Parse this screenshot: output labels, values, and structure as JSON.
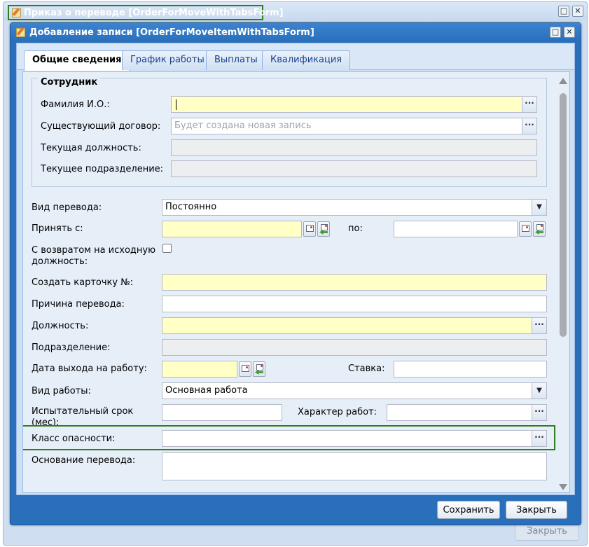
{
  "outer_window": {
    "title": "Приказ о переводе [OrderForMoveWithTabsForm]",
    "bg_close_button": "Закрыть"
  },
  "dialog": {
    "title": "Добавление записи [OrderForMoveItemWithTabsForm]",
    "buttons": {
      "save": "Сохранить",
      "close": "Закрыть"
    }
  },
  "tabs": [
    {
      "label": "Общие сведения",
      "active": true
    },
    {
      "label": "График работы",
      "active": false
    },
    {
      "label": "Выплаты",
      "active": false
    },
    {
      "label": "Квалификация",
      "active": false
    }
  ],
  "employee": {
    "legend": "Сотрудник",
    "fio_label": "Фамилия И.О.:",
    "fio_value": "",
    "contract_label": "Существующий договор:",
    "contract_placeholder": "Будет создана новая запись",
    "position_label": "Текущая должность:",
    "position_value": "",
    "department_label": "Текущее подразделение:",
    "department_value": ""
  },
  "form": {
    "transfer_type_label": "Вид перевода:",
    "transfer_type_value": "Постоянно",
    "accept_from_label": "Принять с:",
    "accept_from_value": "",
    "to_label": "по:",
    "to_value": "",
    "return_label": "С возвратом на исходную должность:",
    "return_checked": false,
    "card_label": "Создать карточку №:",
    "card_value": "",
    "reason_label": "Причина перевода:",
    "reason_value": "",
    "position_label": "Должность:",
    "position_value": "",
    "department_label": "Подразделение:",
    "department_value": "",
    "start_date_label": "Дата выхода на работу:",
    "start_date_value": "",
    "rate_label": "Ставка:",
    "rate_value": "",
    "work_type_label": "Вид работы:",
    "work_type_value": "Основная работа",
    "probation_label": "Испытательный срок (мес):",
    "probation_value": "",
    "work_nature_label": "Характер работ:",
    "work_nature_value": "",
    "hazard_class_label": "Класс опасности:",
    "hazard_class_value": "",
    "basis_label": "Основание перевода:",
    "basis_value": ""
  },
  "icons": {
    "ellipsis": "···",
    "combo_arrow": "▼",
    "maximize": "□",
    "close": "✕"
  },
  "colors": {
    "required_field": "#ffffc6",
    "readonly_field": "#eceef0",
    "dialog_header": "#2a6fb9",
    "highlight": "#2f7d1c"
  }
}
